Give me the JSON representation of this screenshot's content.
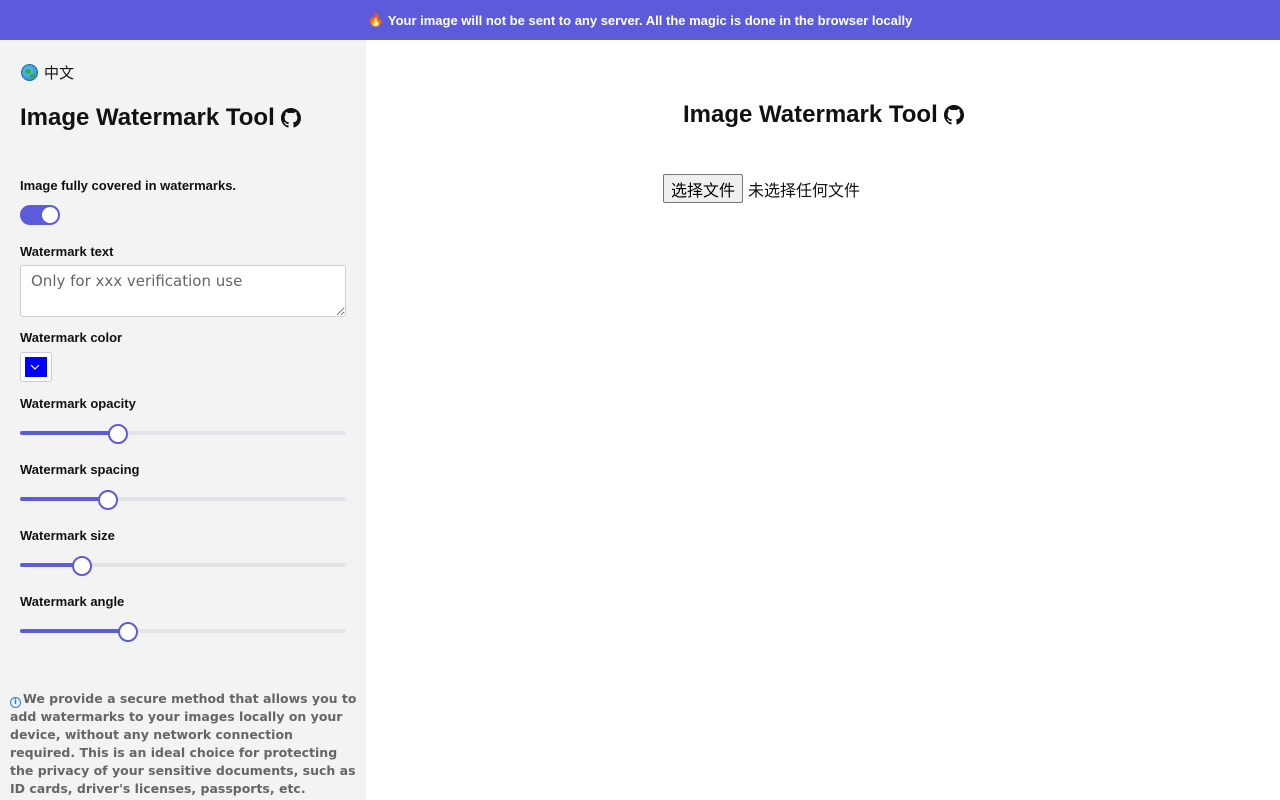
{
  "banner": {
    "icon": "fire-icon",
    "text": "Your image will not be sent to any server. All the magic is done in the browser locally"
  },
  "sidebar": {
    "language_label": "中文",
    "title": "Image Watermark Tool",
    "full_cover": {
      "label": "Image fully covered in watermarks.",
      "enabled": true
    },
    "watermark_text": {
      "label": "Watermark text",
      "placeholder": "Only for xxx verification use"
    },
    "watermark_color": {
      "label": "Watermark color",
      "value": "#0000ff"
    },
    "opacity": {
      "label": "Watermark opacity",
      "percent": 30
    },
    "spacing": {
      "label": "Watermark spacing",
      "percent": 27
    },
    "size": {
      "label": "Watermark size",
      "percent": 19
    },
    "angle": {
      "label": "Watermark angle",
      "percent": 33
    },
    "info_text": "We provide a secure method that allows you to add watermarks to your images locally on your device, without any network connection required. This is an ideal choice for protecting the privacy of your sensitive documents, such as ID cards, driver's licenses, passports, etc."
  },
  "main": {
    "title": "Image Watermark Tool",
    "file_button_label": "选择文件",
    "file_status": "未选择任何文件"
  },
  "colors": {
    "accent": "#5b5bdc",
    "sidebar_bg": "#f3f3f3"
  }
}
